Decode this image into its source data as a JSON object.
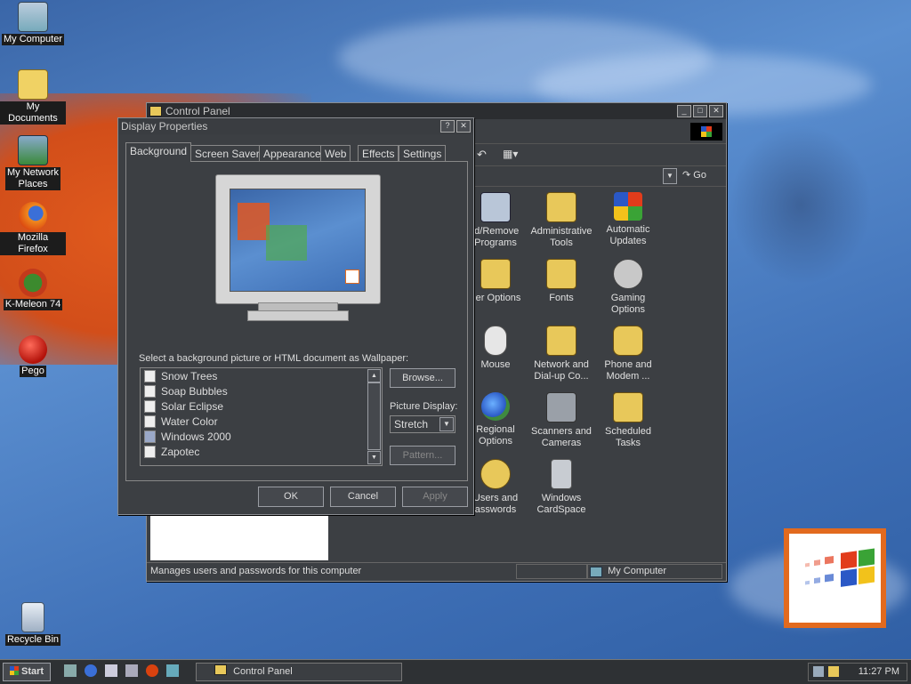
{
  "desktop": {
    "icons": [
      {
        "label": "My Computer",
        "icon": "computer-icon"
      },
      {
        "label": "My Documents",
        "icon": "folder-icon"
      },
      {
        "label": "My Network\nPlaces",
        "icon": "network-icon"
      },
      {
        "label": "Mozilla Firefox",
        "icon": "firefox-icon"
      },
      {
        "label": "K-Meleon 74",
        "icon": "kmeleon-icon"
      },
      {
        "label": "Pego",
        "icon": "pego-icon"
      },
      {
        "label": "Recycle Bin",
        "icon": "recycle-bin-icon"
      }
    ]
  },
  "control_panel": {
    "title": "Control Panel",
    "go_label": "Go",
    "status_text": "Manages users and passwords for this computer",
    "status_zone": "My Computer",
    "items": [
      {
        "label": "ld/Remove\nPrograms",
        "color": "#b9c6d8"
      },
      {
        "label": "Administrative\nTools",
        "color": "#e8c85a"
      },
      {
        "label": "Automatic\nUpdates",
        "color": "#4a8fd8"
      },
      {
        "label": "der Options",
        "color": "#e8c85a"
      },
      {
        "label": "Fonts",
        "color": "#e8c85a"
      },
      {
        "label": "Gaming\nOptions",
        "color": "#c8c8c8"
      },
      {
        "label": "Mouse",
        "color": "#e6e6e6"
      },
      {
        "label": "Network and\nDial-up Co...",
        "color": "#e8c85a"
      },
      {
        "label": "Phone and\nModem ...",
        "color": "#e8c85a"
      },
      {
        "label": "Regional\nOptions",
        "color": "#3f8a3f"
      },
      {
        "label": "Scanners and\nCameras",
        "color": "#9aa0a8"
      },
      {
        "label": "Scheduled\nTasks",
        "color": "#e8c85a"
      },
      {
        "label": "Users and\nasswords",
        "color": "#e8c85a"
      },
      {
        "label": "Windows\nCardSpace",
        "color": "#c8ccd2"
      }
    ]
  },
  "display_properties": {
    "title": "Display Properties",
    "tabs": [
      "Background",
      "Screen Saver",
      "Appearance",
      "Web",
      "Effects",
      "Settings"
    ],
    "wallpaper_prompt": "Select a background picture or HTML document as Wallpaper:",
    "wallpapers": [
      "Snow Trees",
      "Soap Bubbles",
      "Solar Eclipse",
      "Water Color",
      "Windows 2000",
      "Zapotec"
    ],
    "browse_label": "Browse...",
    "picture_display_label": "Picture Display:",
    "picture_display_value": "Stretch",
    "pattern_label": "Pattern...",
    "ok_label": "OK",
    "cancel_label": "Cancel",
    "apply_label": "Apply"
  },
  "taskbar": {
    "start_label": "Start",
    "task_label": "Control Panel",
    "clock": "11:27 PM"
  }
}
